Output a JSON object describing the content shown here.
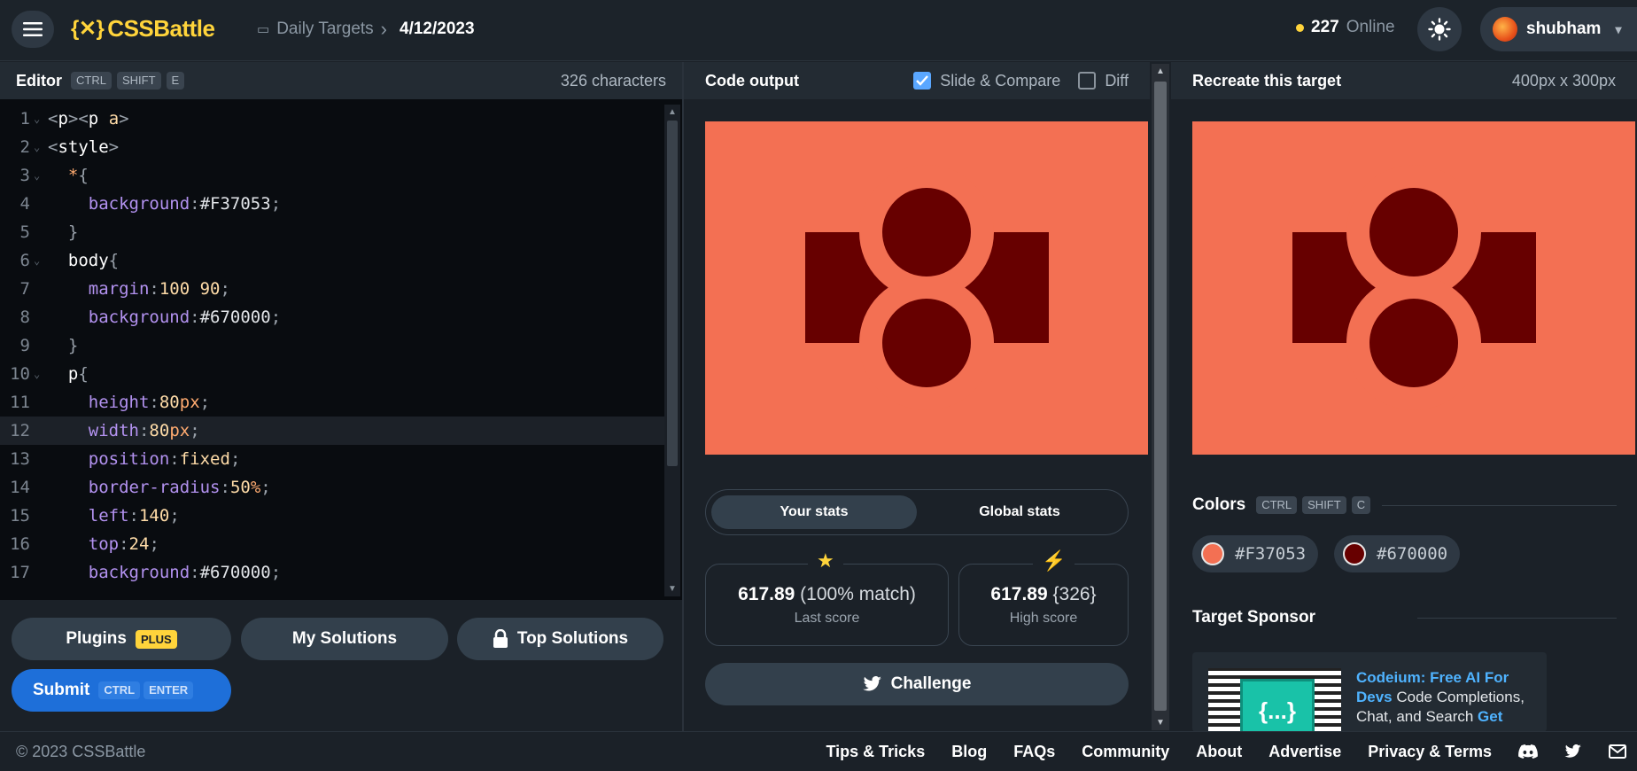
{
  "header": {
    "logo_text": "CSSBattle",
    "breadcrumb_section": "Daily Targets",
    "breadcrumb_date": "4/12/2023",
    "online_count": "227",
    "online_label": "Online",
    "username": "shubham"
  },
  "editor": {
    "title": "Editor",
    "shortcut": [
      "CTRL",
      "SHIFT",
      "E"
    ],
    "char_count": "326 characters",
    "active_line": 12
  },
  "code_output": {
    "title": "Code output",
    "slide_compare_label": "Slide & Compare",
    "slide_compare_checked": true,
    "diff_label": "Diff",
    "diff_checked": false
  },
  "target": {
    "title": "Recreate this target",
    "size": "400px x 300px"
  },
  "buttons": {
    "plugins": "Plugins",
    "plugins_badge": "PLUS",
    "my_solutions": "My Solutions",
    "top_solutions": "Top Solutions",
    "submit": "Submit",
    "submit_shortcut": [
      "CTRL",
      "ENTER"
    ],
    "challenge": "Challenge"
  },
  "stats": {
    "tab_your": "Your stats",
    "tab_global": "Global stats",
    "last_score_value": "617.89",
    "last_score_match": "(100% match)",
    "last_score_label": "Last score",
    "high_score_value": "617.89",
    "high_score_chars": "{326}",
    "high_score_label": "High score"
  },
  "colors": {
    "title": "Colors",
    "shortcut": [
      "CTRL",
      "SHIFT",
      "C"
    ],
    "list": [
      {
        "hex": "#F37053"
      },
      {
        "hex": "#670000"
      }
    ]
  },
  "sponsor": {
    "title": "Target Sponsor",
    "headline": "Codeium: Free AI For Devs",
    "body": " Code Completions, Chat, and Search ",
    "cta": "Get",
    "icon_text": "{...}"
  },
  "footer": {
    "copyright": "© 2023 CSSBattle",
    "links": [
      "Tips & Tricks",
      "Blog",
      "FAQs",
      "Community",
      "About",
      "Advertise",
      "Privacy & Terms"
    ]
  },
  "code_lines": [
    {
      "n": "1",
      "fold": true,
      "segs": [
        [
          "punct",
          "<"
        ],
        [
          "tag",
          "p"
        ],
        [
          "punct",
          "><"
        ],
        [
          "tag",
          "p "
        ],
        [
          "val",
          "a"
        ],
        [
          "punct",
          ">"
        ]
      ]
    },
    {
      "n": "2",
      "fold": true,
      "segs": [
        [
          "punct",
          "<"
        ],
        [
          "tag",
          "style"
        ],
        [
          "punct",
          ">"
        ]
      ]
    },
    {
      "n": "3",
      "fold": true,
      "segs": [
        [
          "t",
          "  "
        ],
        [
          "sel",
          "*"
        ],
        [
          "punct",
          "{"
        ]
      ]
    },
    {
      "n": "4",
      "fold": false,
      "segs": [
        [
          "t",
          "    "
        ],
        [
          "prop",
          "background"
        ],
        [
          "punct",
          ":"
        ],
        [
          "hex",
          "#F37053"
        ],
        [
          "punct",
          ";"
        ]
      ]
    },
    {
      "n": "5",
      "fold": false,
      "segs": [
        [
          "t",
          "  "
        ],
        [
          "punct",
          "}"
        ]
      ]
    },
    {
      "n": "6",
      "fold": true,
      "segs": [
        [
          "t",
          "  "
        ],
        [
          "tag",
          "body"
        ],
        [
          "punct",
          "{"
        ]
      ]
    },
    {
      "n": "7",
      "fold": false,
      "segs": [
        [
          "t",
          "    "
        ],
        [
          "prop",
          "margin"
        ],
        [
          "punct",
          ":"
        ],
        [
          "val",
          "100 90"
        ],
        [
          "punct",
          ";"
        ]
      ]
    },
    {
      "n": "8",
      "fold": false,
      "segs": [
        [
          "t",
          "    "
        ],
        [
          "prop",
          "background"
        ],
        [
          "punct",
          ":"
        ],
        [
          "hex",
          "#670000"
        ],
        [
          "punct",
          ";"
        ]
      ]
    },
    {
      "n": "9",
      "fold": false,
      "segs": [
        [
          "t",
          "  "
        ],
        [
          "punct",
          "}"
        ]
      ]
    },
    {
      "n": "10",
      "fold": true,
      "segs": [
        [
          "t",
          "  "
        ],
        [
          "tag",
          "p"
        ],
        [
          "punct",
          "{"
        ]
      ]
    },
    {
      "n": "11",
      "fold": false,
      "segs": [
        [
          "t",
          "    "
        ],
        [
          "prop",
          "height"
        ],
        [
          "punct",
          ":"
        ],
        [
          "val",
          "80"
        ],
        [
          "num",
          "px"
        ],
        [
          "punct",
          ";"
        ]
      ]
    },
    {
      "n": "12",
      "fold": false,
      "segs": [
        [
          "t",
          "    "
        ],
        [
          "prop",
          "width"
        ],
        [
          "punct",
          ":"
        ],
        [
          "val",
          "80"
        ],
        [
          "num",
          "px"
        ],
        [
          "punct",
          ";"
        ]
      ]
    },
    {
      "n": "13",
      "fold": false,
      "segs": [
        [
          "t",
          "    "
        ],
        [
          "prop",
          "position"
        ],
        [
          "punct",
          ":"
        ],
        [
          "val",
          "fixed"
        ],
        [
          "punct",
          ";"
        ]
      ]
    },
    {
      "n": "14",
      "fold": false,
      "segs": [
        [
          "t",
          "    "
        ],
        [
          "prop",
          "border-radius"
        ],
        [
          "punct",
          ":"
        ],
        [
          "val",
          "50"
        ],
        [
          "num",
          "%"
        ],
        [
          "punct",
          ";"
        ]
      ]
    },
    {
      "n": "15",
      "fold": false,
      "segs": [
        [
          "t",
          "    "
        ],
        [
          "prop",
          "left"
        ],
        [
          "punct",
          ":"
        ],
        [
          "val",
          "140"
        ],
        [
          "punct",
          ";"
        ]
      ]
    },
    {
      "n": "16",
      "fold": false,
      "segs": [
        [
          "t",
          "    "
        ],
        [
          "prop",
          "top"
        ],
        [
          "punct",
          ":"
        ],
        [
          "val",
          "24"
        ],
        [
          "punct",
          ";"
        ]
      ]
    },
    {
      "n": "17",
      "fold": false,
      "segs": [
        [
          "t",
          "    "
        ],
        [
          "prop",
          "background"
        ],
        [
          "punct",
          ":"
        ],
        [
          "hex",
          "#670000"
        ],
        [
          "punct",
          ";"
        ]
      ]
    }
  ],
  "theme": {
    "accent_yellow": "#ffd43b",
    "submit_blue": "#1e6fd9",
    "target_bg": "#F37053",
    "target_fg": "#670000"
  }
}
